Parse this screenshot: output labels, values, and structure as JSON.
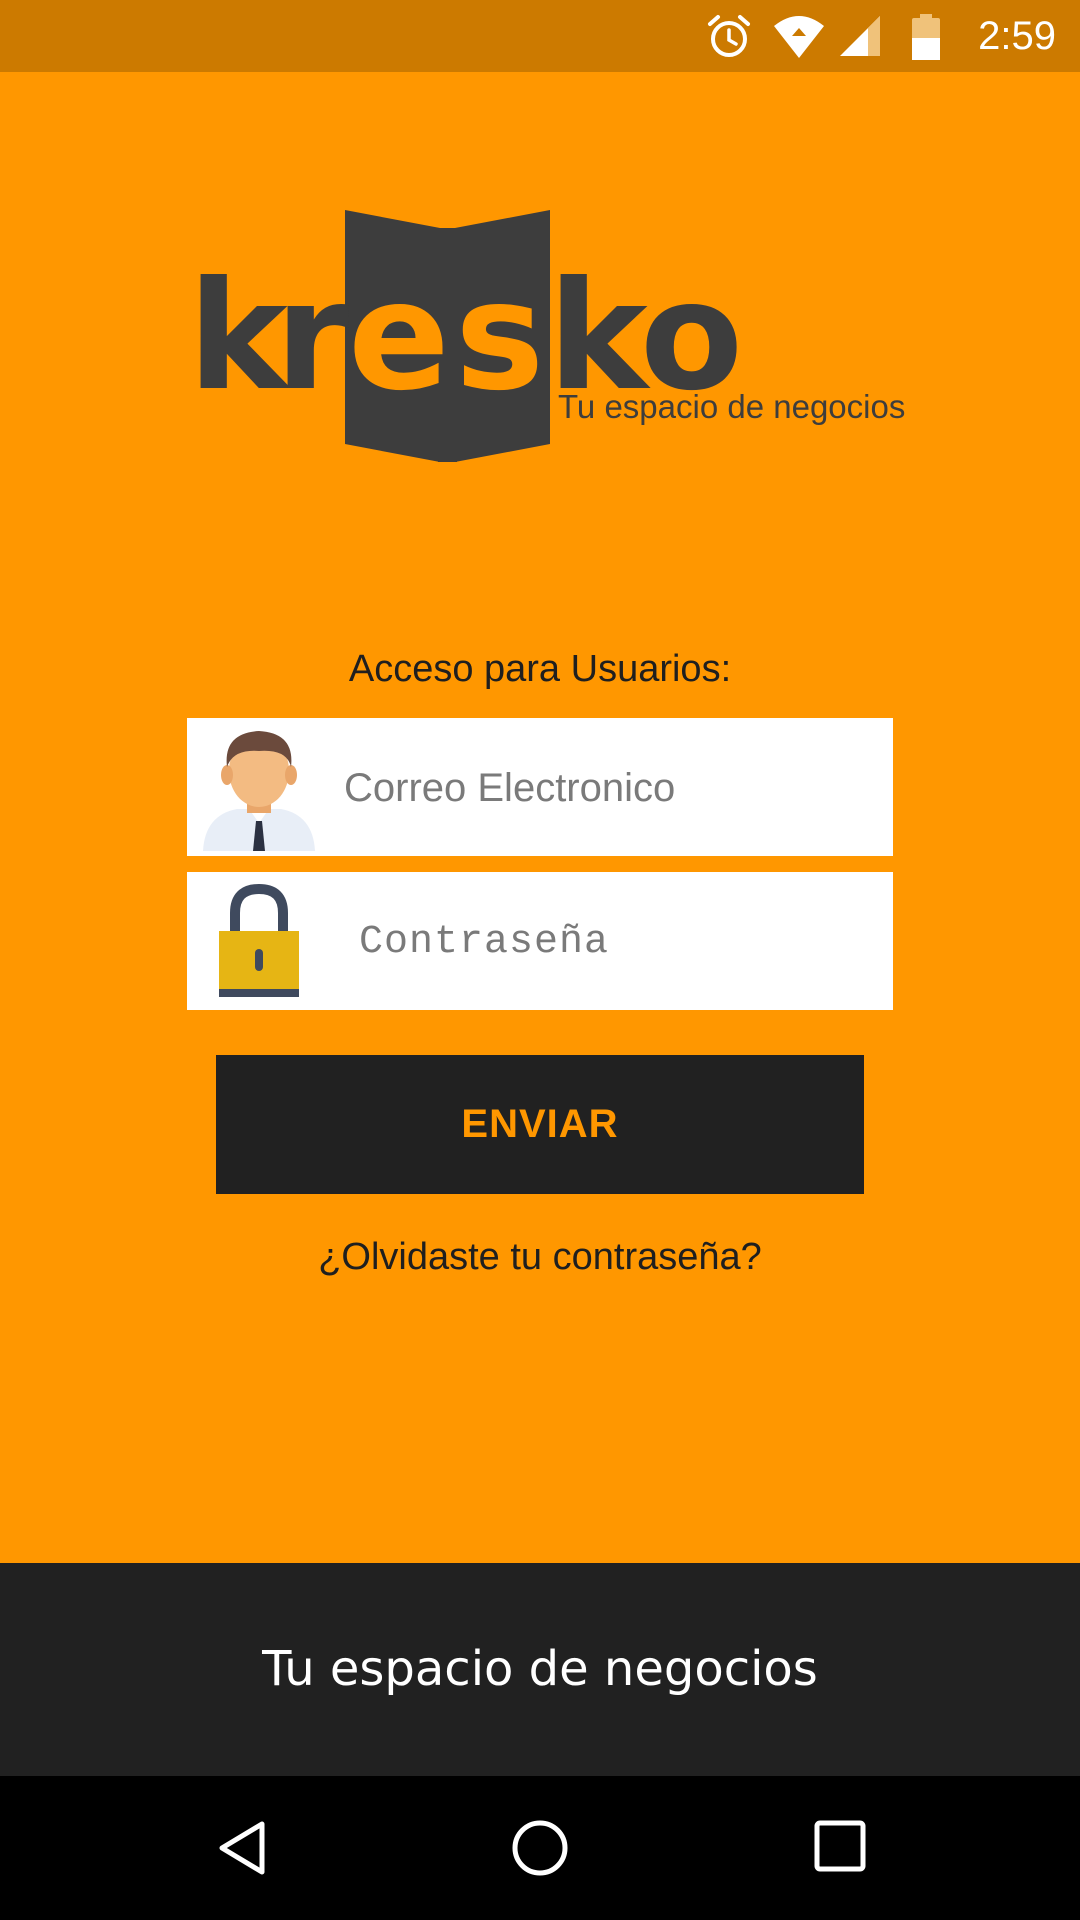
{
  "status_bar": {
    "time": "2:59",
    "icons": [
      "alarm-icon",
      "wifi-icon",
      "cell-signal-icon",
      "battery-icon"
    ],
    "background": "#cc7a00"
  },
  "logo": {
    "text_k": "k",
    "text_r": "r",
    "text_e": "e",
    "text_s": "s",
    "text_k2": "k",
    "text_o": "o",
    "tagline": "Tu espacio de negocios"
  },
  "form": {
    "access_label": "Acceso para Usuarios:",
    "email_placeholder": "Correo Electronico",
    "password_placeholder": "Contraseña",
    "send_label": "ENVIAR",
    "forgot_label": "¿Olvidaste tu contraseña?"
  },
  "footer": {
    "text": "Tu espacio de negocios"
  },
  "colors": {
    "accent": "#ff9700",
    "dark": "#212121",
    "status_bar": "#cc7a00"
  }
}
